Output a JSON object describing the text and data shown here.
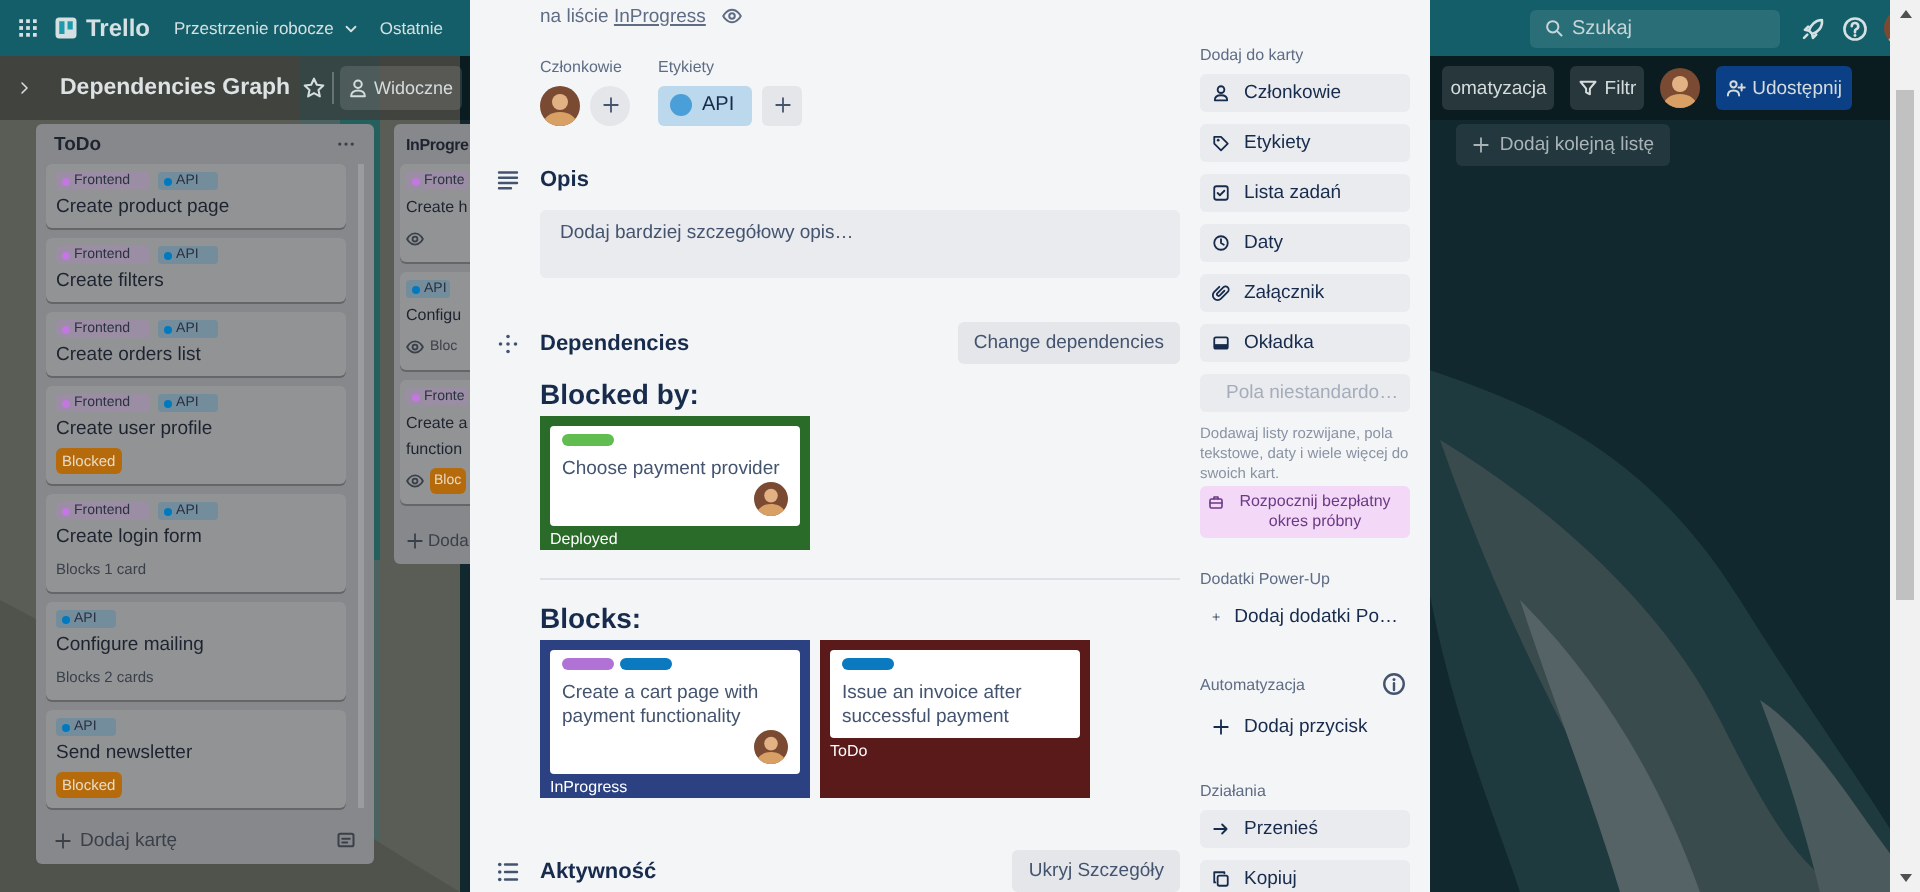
{
  "top_bar": {
    "logo": "Trello",
    "menus": [
      {
        "label": "Przestrzenie robocze",
        "dropdown": true
      },
      {
        "label": "Ostatnie",
        "dropdown": false
      }
    ],
    "search": {
      "placeholder": "Szukaj"
    }
  },
  "board_header": {
    "title": "Dependencies Graph",
    "starred": false,
    "visibility": "Widoczne",
    "buttons": [
      {
        "kind": "automation",
        "label": "omatyzacja"
      },
      {
        "kind": "filter",
        "label": "Filtr"
      },
      {
        "kind": "share",
        "label": "Udostępnij"
      }
    ]
  },
  "lists": [
    {
      "title": "ToDo",
      "add_card": "Dodaj kartę",
      "cards": [
        {
          "labels": [
            {
              "text": "Frontend",
              "color": "#c377e0"
            },
            {
              "text": "API",
              "color": "#0079bf"
            }
          ],
          "title": [
            "Create product page"
          ],
          "watched": false
        },
        {
          "labels": [
            {
              "text": "Frontend",
              "color": "#c377e0"
            },
            {
              "text": "API",
              "color": "#0079bf"
            }
          ],
          "title": [
            "Create filters"
          ],
          "watched": false
        },
        {
          "labels": [
            {
              "text": "Frontend",
              "color": "#c377e0"
            },
            {
              "text": "API",
              "color": "#0079bf"
            }
          ],
          "title": [
            "Create orders list"
          ],
          "watched": false
        },
        {
          "labels": [
            {
              "text": "Frontend",
              "color": "#c377e0"
            },
            {
              "text": "API",
              "color": "#0079bf"
            }
          ],
          "title": [
            "Create user profile"
          ],
          "watched": false,
          "badge": "Blocked"
        },
        {
          "labels": [
            {
              "text": "Frontend",
              "color": "#c377e0"
            },
            {
              "text": "API",
              "color": "#0079bf"
            }
          ],
          "title": [
            "Create login form"
          ],
          "watched": false,
          "note": "Blocks 1 card"
        },
        {
          "labels": [
            {
              "text": "API",
              "color": "#0079bf"
            }
          ],
          "title": [
            "Configure mailing"
          ],
          "watched": false,
          "note": "Blocks 2 cards"
        },
        {
          "labels": [
            {
              "text": "API",
              "color": "#0079bf"
            }
          ],
          "title": [
            "Send newsletter"
          ],
          "watched": false,
          "badge": "Blocked"
        }
      ]
    },
    {
      "title": "InProgre",
      "add_card": "Doda",
      "cards": [
        {
          "labels": [
            {
              "text": "Fronte",
              "color": "#c377e0"
            }
          ],
          "title": [
            "Create h"
          ],
          "watched": true
        },
        {
          "labels": [
            {
              "text": "API",
              "color": "#0079bf"
            }
          ],
          "title": [
            "Configu"
          ],
          "watched": true,
          "note": "Bloc"
        },
        {
          "labels": [
            {
              "text": "Fronte",
              "color": "#c377e0"
            }
          ],
          "title": [
            "Create a",
            "function"
          ],
          "watched": true,
          "badge": "Bloc"
        }
      ]
    }
  ],
  "add_list": "Dodaj kolejną listę",
  "card_modal": {
    "list_prefix": "na liście",
    "list_name": "InProgress",
    "watched": true,
    "members_label": "Członkowie",
    "labels_label": "Etykiety",
    "labels": [
      {
        "text": "API",
        "color": "#4a9fd8"
      }
    ],
    "description": {
      "heading": "Opis",
      "placeholder": "Dodaj bardziej szczegółowy opis…"
    },
    "dependencies": {
      "heading": "Dependencies",
      "button": "Change dependencies",
      "groups": [
        {
          "heading": "Blocked by:",
          "cards": [
            {
              "title": "Choose payment provider",
              "list": "Deployed",
              "color": "#2a6b2a",
              "member": true,
              "labels": [
                {
                  "color": "#61bd4f"
                }
              ]
            }
          ]
        },
        {
          "heading": "Blocks:",
          "cards": [
            {
              "title": "Create a cart page with payment functionality",
              "list": "InProgress",
              "color": "#2b4182",
              "member": true,
              "labels": [
                {
                  "color": "#b172d6"
                },
                {
                  "color": "#0a79bf"
                }
              ]
            },
            {
              "title": "Issue an invoice after successful payment",
              "list": "ToDo",
              "color": "#5a1a1a",
              "member": false,
              "labels": [
                {
                  "color": "#0a79bf"
                }
              ]
            }
          ]
        }
      ]
    },
    "activity": {
      "heading": "Aktywność",
      "button": "Ukryj Szczegóły"
    }
  },
  "sidebar": {
    "sections": [
      {
        "title": "Dodaj do karty",
        "info": false,
        "items": [
          {
            "kind": "button",
            "label": "Członkowie",
            "disabled": false
          },
          {
            "kind": "button",
            "label": "Etykiety",
            "disabled": false
          },
          {
            "kind": "button",
            "label": "Lista zadań",
            "disabled": false
          },
          {
            "kind": "button",
            "label": "Daty",
            "disabled": false
          },
          {
            "kind": "button",
            "label": "Załącznik",
            "disabled": false
          },
          {
            "kind": "button",
            "label": "Okładka",
            "disabled": false
          },
          {
            "kind": "button",
            "label": "Pola niestandardo…",
            "disabled": true
          }
        ],
        "note": "Dodawaj listy rozwijane, pola tekstowe, daty i wiele więcej do swoich kart.",
        "promo": "Rozpocznij bezpłatny okres próbny"
      },
      {
        "title": "Dodatki Power-Up",
        "info": false,
        "items": [
          {
            "kind": "add",
            "label": "Dodaj dodatki Po…",
            "disabled": false
          }
        ]
      },
      {
        "title": "Automatyzacja",
        "info": true,
        "items": [
          {
            "kind": "add",
            "label": "Dodaj przycisk",
            "disabled": false
          }
        ]
      },
      {
        "title": "Działania",
        "info": false,
        "items": [
          {
            "kind": "button",
            "label": "Przenieś",
            "disabled": false
          },
          {
            "kind": "button",
            "label": "Kopiuj",
            "disabled": false
          }
        ]
      }
    ]
  }
}
